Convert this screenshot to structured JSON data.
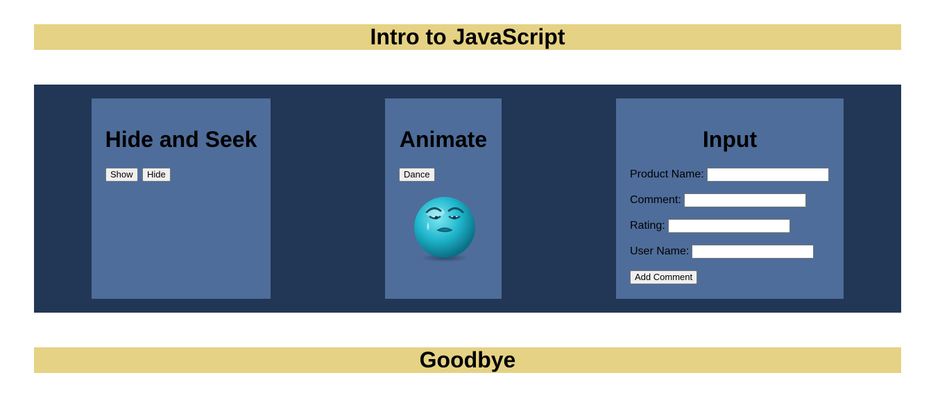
{
  "header": {
    "title": "Intro to JavaScript"
  },
  "hide_and_seek": {
    "title": "Hide and Seek",
    "show_label": "Show",
    "hide_label": "Hide"
  },
  "animate": {
    "title": "Animate",
    "dance_label": "Dance",
    "image_icon": "sad-face-icon"
  },
  "input_panel": {
    "title": "Input",
    "fields": [
      {
        "label": "Product Name:",
        "value": ""
      },
      {
        "label": "Comment:",
        "value": ""
      },
      {
        "label": "Rating:",
        "value": ""
      },
      {
        "label": "User Name:",
        "value": ""
      }
    ],
    "add_comment_label": "Add Comment"
  },
  "footer": {
    "title": "Goodbye"
  },
  "colors": {
    "banner": "#e5d284",
    "main_bg": "#223656",
    "panel_bg": "#4e6d9a",
    "face": "#1fb6cc"
  }
}
